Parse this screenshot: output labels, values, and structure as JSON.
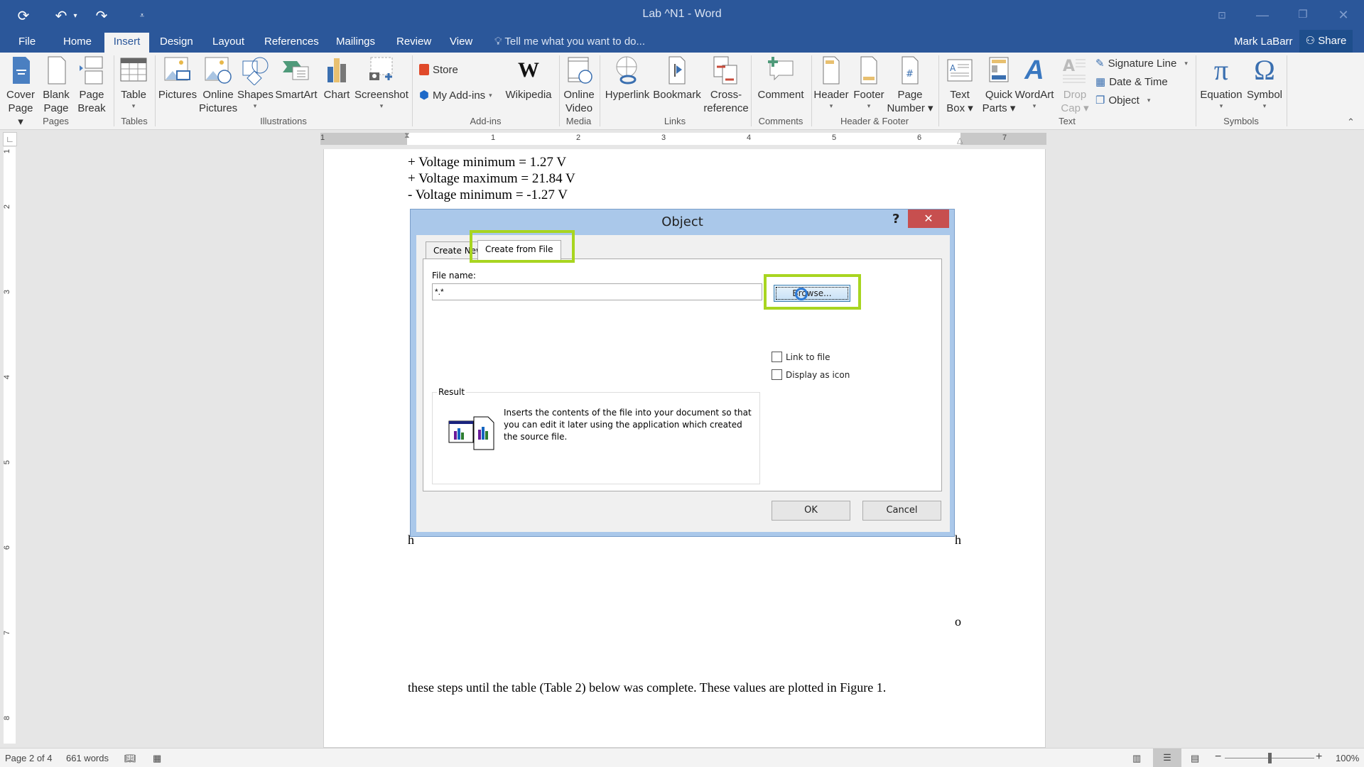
{
  "titlebar": {
    "title": "Lab ^N1 - Word",
    "qat": {
      "save_icon": "autosave-icon",
      "undo_icon": "undo-icon",
      "redo_icon": "redo-icon",
      "customize_icon": "customize-qat-icon"
    },
    "window_controls": [
      "ribbon-display-options",
      "minimize",
      "restore",
      "close"
    ]
  },
  "tabs": [
    {
      "label": "File"
    },
    {
      "label": "Home"
    },
    {
      "label": "Insert",
      "active": true
    },
    {
      "label": "Design"
    },
    {
      "label": "Layout"
    },
    {
      "label": "References"
    },
    {
      "label": "Mailings"
    },
    {
      "label": "Review"
    },
    {
      "label": "View"
    }
  ],
  "tellme": "Tell me what you want to do...",
  "user": "Mark LaBarr",
  "share": "Share",
  "ribbon": {
    "groups": [
      "Pages",
      "Tables",
      "Illustrations",
      "Add-ins",
      "Media",
      "Links",
      "Comments",
      "Header & Footer",
      "Text",
      "Symbols"
    ],
    "pages": [
      {
        "l1": "Cover",
        "l2": "Page ▾"
      },
      {
        "l1": "Blank",
        "l2": "Page"
      },
      {
        "l1": "Page",
        "l2": "Break"
      }
    ],
    "tables": [
      {
        "l1": "Table",
        "l2": "▾"
      }
    ],
    "illustrations": [
      {
        "l1": "Pictures"
      },
      {
        "l1": "Online",
        "l2": "Pictures"
      },
      {
        "l1": "Shapes",
        "l2": "▾"
      },
      {
        "l1": "SmartArt"
      },
      {
        "l1": "Chart"
      },
      {
        "l1": "Screenshot",
        "l2": "▾"
      }
    ],
    "addins": {
      "store": "Store",
      "myaddins": "My Add-ins",
      "wikipedia": "Wikipedia"
    },
    "media": [
      {
        "l1": "Online",
        "l2": "Video"
      }
    ],
    "links": [
      {
        "l1": "Hyperlink"
      },
      {
        "l1": "Bookmark"
      },
      {
        "l1": "Cross-",
        "l2": "reference"
      }
    ],
    "comments": [
      {
        "l1": "Comment"
      }
    ],
    "headerfooter": [
      {
        "l1": "Header",
        "l2": "▾"
      },
      {
        "l1": "Footer",
        "l2": "▾"
      },
      {
        "l1": "Page",
        "l2": "Number ▾"
      }
    ],
    "text": [
      {
        "l1": "Text",
        "l2": "Box ▾"
      },
      {
        "l1": "Quick",
        "l2": "Parts ▾"
      },
      {
        "l1": "WordArt",
        "l2": "▾"
      },
      {
        "l1": "Drop",
        "l2": "Cap ▾"
      }
    ],
    "text_small": {
      "signature": "Signature Line",
      "datetime": "Date & Time",
      "object": "Object"
    },
    "symbols": [
      {
        "l1": "Equation",
        "l2": "▾"
      },
      {
        "l1": "Symbol",
        "l2": "▾"
      }
    ]
  },
  "ruler": {
    "h_ticks": [
      "1",
      "1",
      "2",
      "3",
      "4",
      "5",
      "6",
      "7"
    ],
    "v_ticks": [
      "1",
      "2",
      "3",
      "4",
      "5",
      "6",
      "7",
      "8"
    ]
  },
  "document": {
    "lines": [
      "+ Voltage minimum = 1.27 V",
      "+ Voltage maximum = 21.84 V",
      "- Voltage minimum = -1.27 V"
    ],
    "bottom_line": "these steps until the table (Table 2) below was complete. These values are plotted in Figure 1.",
    "right_fragment_1": "h",
    "right_fragment_2": "o"
  },
  "dialog": {
    "title": "Object",
    "help": "?",
    "close": "✕",
    "tabs": [
      {
        "label": "Create New"
      },
      {
        "label": "Create from File",
        "selected": true
      }
    ],
    "file_name_label": "File name:",
    "file_name_value": "*.*",
    "browse": "Browse...",
    "link_to_file": {
      "label": "Link to file",
      "checked": false
    },
    "display_as_icon": {
      "label": "Display as icon",
      "checked": false
    },
    "result_label": "Result",
    "result_text": "Inserts the contents of the file into your document so that you can edit it later using the application which created the source file.",
    "ok": "OK",
    "cancel": "Cancel",
    "highlight_color": "#a8d520"
  },
  "statusbar": {
    "page": "Page 2 of 4",
    "words": "661 words",
    "zoom": "100%",
    "zoom_level_percent": 100
  }
}
